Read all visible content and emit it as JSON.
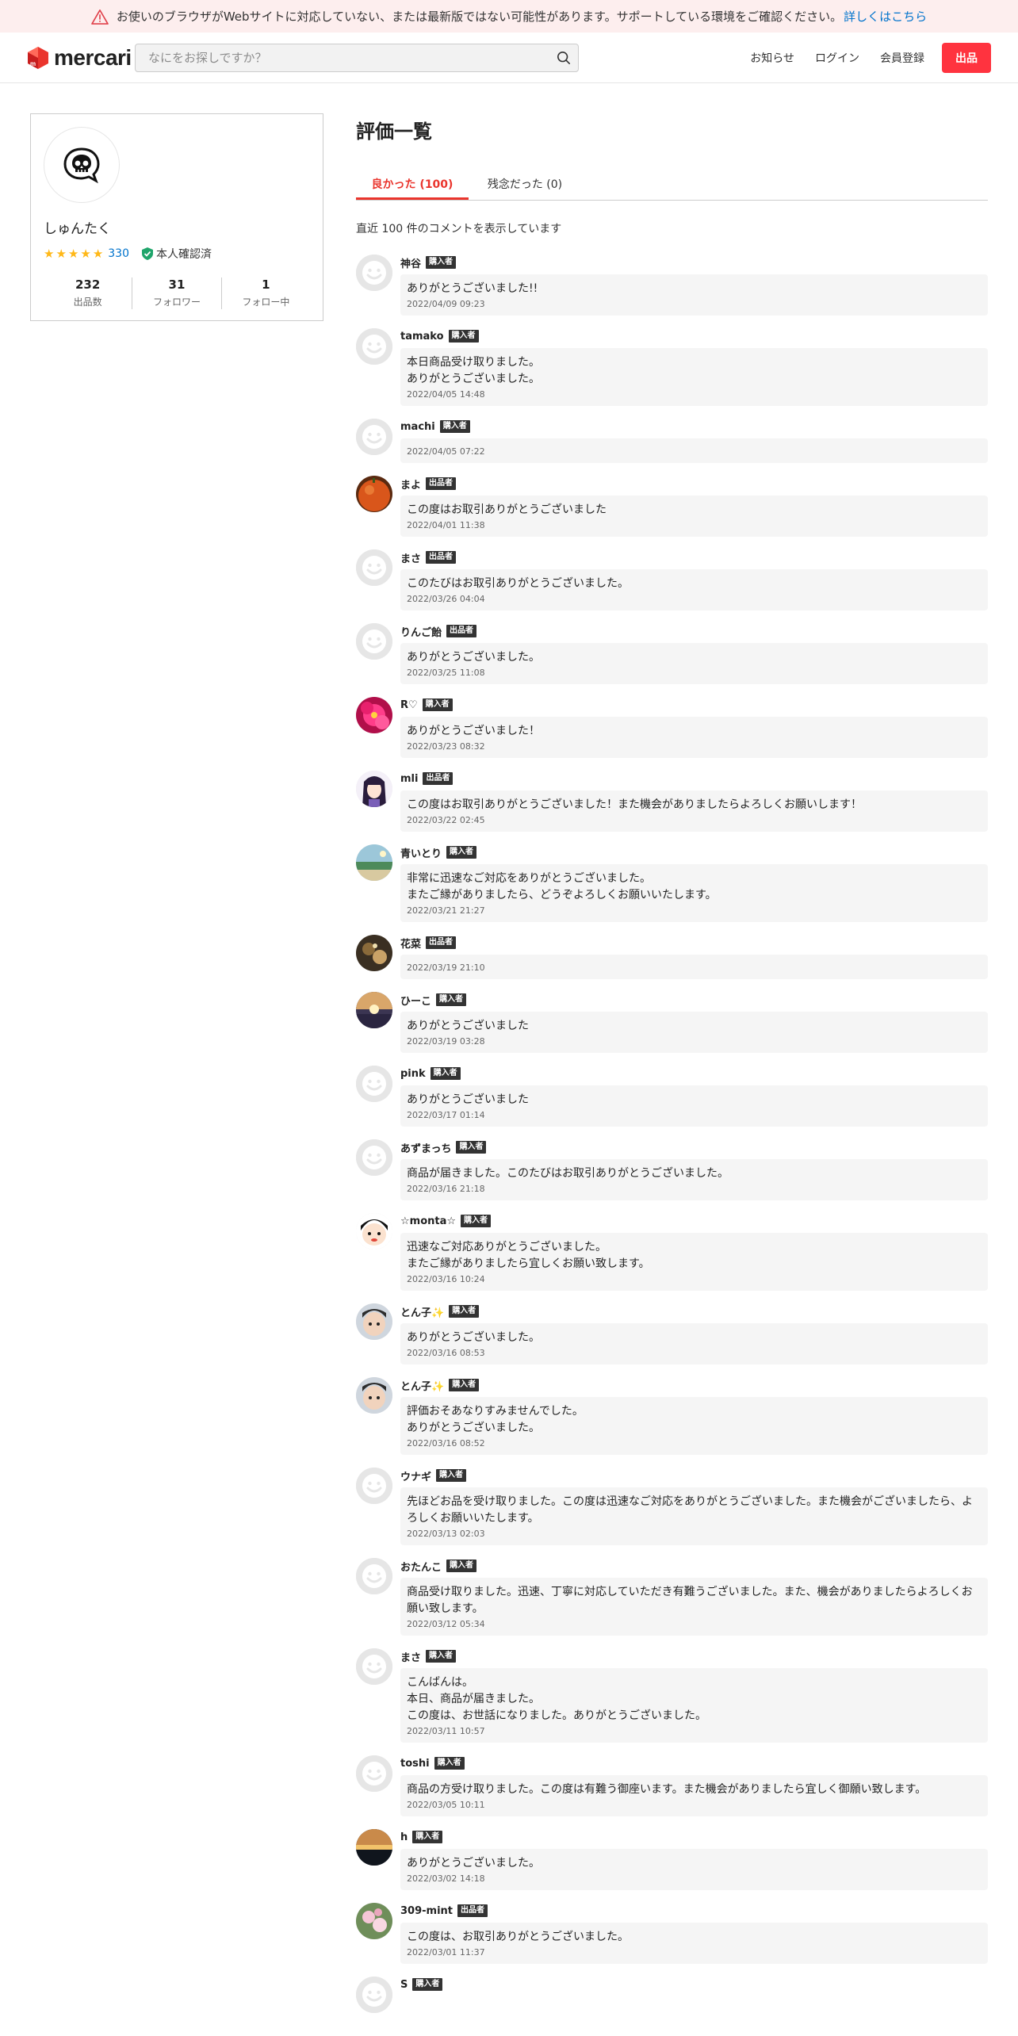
{
  "banner": {
    "message": "お使いのブラウザがWebサイトに対応していない、または最新版ではない可能性があります。サポートしている環境をご確認ください。",
    "link": "詳しくはこちら",
    "icon": "warning-icon"
  },
  "header": {
    "logo_text": "mercari",
    "search_placeholder": "なにをお探しですか？",
    "nav": {
      "notifications": "お知らせ",
      "login": "ログイン",
      "signup": "会員登録",
      "sell": "出品"
    }
  },
  "colors": {
    "accent": "#ea352d",
    "sell_button": "#ff333f",
    "link": "#0073cc",
    "star": "#ffb818",
    "verified": "#1fa56b"
  },
  "profile": {
    "name": "しゅんたく",
    "rating_stars": 5,
    "rating_count": "330",
    "verified_label": "本人確認済",
    "stats": [
      {
        "value": "232",
        "label": "出品数"
      },
      {
        "value": "31",
        "label": "フォロワー"
      },
      {
        "value": "1",
        "label": "フォロー中"
      }
    ]
  },
  "main": {
    "title": "評価一覧",
    "tabs": [
      {
        "label": "良かった (100)"
      },
      {
        "label": "残念だった (0)"
      }
    ],
    "summary": "直近 100 件のコメントを表示しています"
  },
  "reviews": [
    {
      "name": "神谷",
      "role": "購入者",
      "text": "ありがとうございました!!",
      "date": "2022/04/09 09:23",
      "avatar": "default"
    },
    {
      "name": "tamako",
      "role": "購入者",
      "text": "本日商品受け取りました。\nありがとうございました。",
      "date": "2022/04/05 14:48",
      "avatar": "default"
    },
    {
      "name": "machi",
      "role": "購入者",
      "text": "",
      "date": "2022/04/05 07:22",
      "avatar": "default"
    },
    {
      "name": "まよ",
      "role": "出品者",
      "text": "この度はお取引ありがとうございました",
      "date": "2022/04/01 11:38",
      "avatar": "orange"
    },
    {
      "name": "まさ",
      "role": "出品者",
      "text": "このたびはお取引ありがとうございました。",
      "date": "2022/03/26 04:04",
      "avatar": "default"
    },
    {
      "name": "りんご飴",
      "role": "出品者",
      "text": "ありがとうございました。",
      "date": "2022/03/25 11:08",
      "avatar": "default"
    },
    {
      "name": "R♡",
      "role": "購入者",
      "text": "ありがとうございました！",
      "date": "2022/03/23 08:32",
      "avatar": "flower"
    },
    {
      "name": "mli",
      "role": "出品者",
      "text": "この度はお取引ありがとうございました！また機会がありましたらよろしくお願いします！",
      "date": "2022/03/22 02:45",
      "avatar": "anime"
    },
    {
      "name": "青いとり",
      "role": "購入者",
      "text": "非常に迅速なご対応をありがとうございました。\nまたご縁がありましたら、どうぞよろしくお願いいたします。",
      "date": "2022/03/21 21:27",
      "avatar": "beach"
    },
    {
      "name": "花菜",
      "role": "出品者",
      "text": "",
      "date": "2022/03/19 21:10",
      "avatar": "dark"
    },
    {
      "name": "ひーこ",
      "role": "購入者",
      "text": "ありがとうございました",
      "date": "2022/03/19 03:28",
      "avatar": "sunset"
    },
    {
      "name": "pink",
      "role": "購入者",
      "text": "ありがとうございました",
      "date": "2022/03/17 01:14",
      "avatar": "default"
    },
    {
      "name": "あずまっち",
      "role": "購入者",
      "text": "商品が届きました。このたびはお取引ありがとうございました。",
      "date": "2022/03/16 21:18",
      "avatar": "default"
    },
    {
      "name": "☆monta☆",
      "role": "購入者",
      "text": "迅速なご対応ありがとうございました。\nまたご縁がありましたら宜しくお願い致します。",
      "date": "2022/03/16 10:24",
      "avatar": "cartoon"
    },
    {
      "name": "とん子✨",
      "role": "購入者",
      "text": "ありがとうございました。",
      "date": "2022/03/16 08:53",
      "avatar": "baby"
    },
    {
      "name": "とん子✨",
      "role": "購入者",
      "text": "評価おそあなりすみませんでした。\nありがとうございました。",
      "date": "2022/03/16 08:52",
      "avatar": "baby"
    },
    {
      "name": "ウナギ",
      "role": "購入者",
      "text": "先ほどお品を受け取りました。この度は迅速なご対応をありがとうございました。また機会がございましたら、よろしくお願いいたします。",
      "date": "2022/03/13 02:03",
      "avatar": "default"
    },
    {
      "name": "おたんこ",
      "role": "購入者",
      "text": "商品受け取りました。迅速、丁寧に対応していただき有難うございました。また、機会がありましたらよろしくお願い致します。",
      "date": "2022/03/12 05:34",
      "avatar": "default"
    },
    {
      "name": "まさ",
      "role": "購入者",
      "text": "こんばんは。\n本日、商品が届きました。\nこの度は、お世話になりました。ありがとうございました。",
      "date": "2022/03/11 10:57",
      "avatar": "default"
    },
    {
      "name": "toshi",
      "role": "購入者",
      "text": "商品の方受け取りました。この度は有難う御座います。また機会がありましたら宜しく御願い致します。",
      "date": "2022/03/05 10:11",
      "avatar": "default"
    },
    {
      "name": "h",
      "role": "購入者",
      "text": "ありがとうございました。",
      "date": "2022/03/02 14:18",
      "avatar": "sunset2"
    },
    {
      "name": "309-mint",
      "role": "出品者",
      "text": "この度は、お取引ありがとうございました。",
      "date": "2022/03/01 11:37",
      "avatar": "blossom"
    },
    {
      "name": "S",
      "role": "購入者",
      "text": "",
      "date": "",
      "avatar": "default"
    }
  ]
}
